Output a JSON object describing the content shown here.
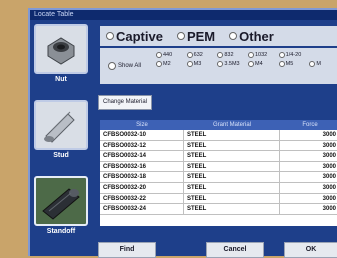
{
  "window": {
    "title": "Locate Table"
  },
  "categories": [
    {
      "label": "Nut"
    },
    {
      "label": "Stud"
    },
    {
      "label": "Standoff"
    }
  ],
  "type_options": [
    "Captive",
    "PEM",
    "Other"
  ],
  "show_all_label": "Show All",
  "thread_options": [
    "440",
    "632",
    "832",
    "1032",
    "1/4-20",
    "M2",
    "M3",
    "3.5M3",
    "M4",
    "M5",
    "M"
  ],
  "change_material_label": "Change Material",
  "table": {
    "headers": [
      "Size",
      "Grant Material",
      "Force"
    ],
    "rows": [
      [
        "CFBSO0032-10",
        "STEEL",
        "3000"
      ],
      [
        "CFBSO0032-12",
        "STEEL",
        "3000"
      ],
      [
        "CFBSO0032-14",
        "STEEL",
        "3000"
      ],
      [
        "CFBSO0032-16",
        "STEEL",
        "3000"
      ],
      [
        "CFBSO0032-18",
        "STEEL",
        "3000"
      ],
      [
        "CFBSO0032-20",
        "STEEL",
        "3000"
      ],
      [
        "CFBSO0032-22",
        "STEEL",
        "3000"
      ],
      [
        "CFBSO0032-24",
        "STEEL",
        "3000"
      ]
    ]
  },
  "buttons": {
    "find": "Find",
    "cancel": "Cancel",
    "ok": "OK"
  }
}
